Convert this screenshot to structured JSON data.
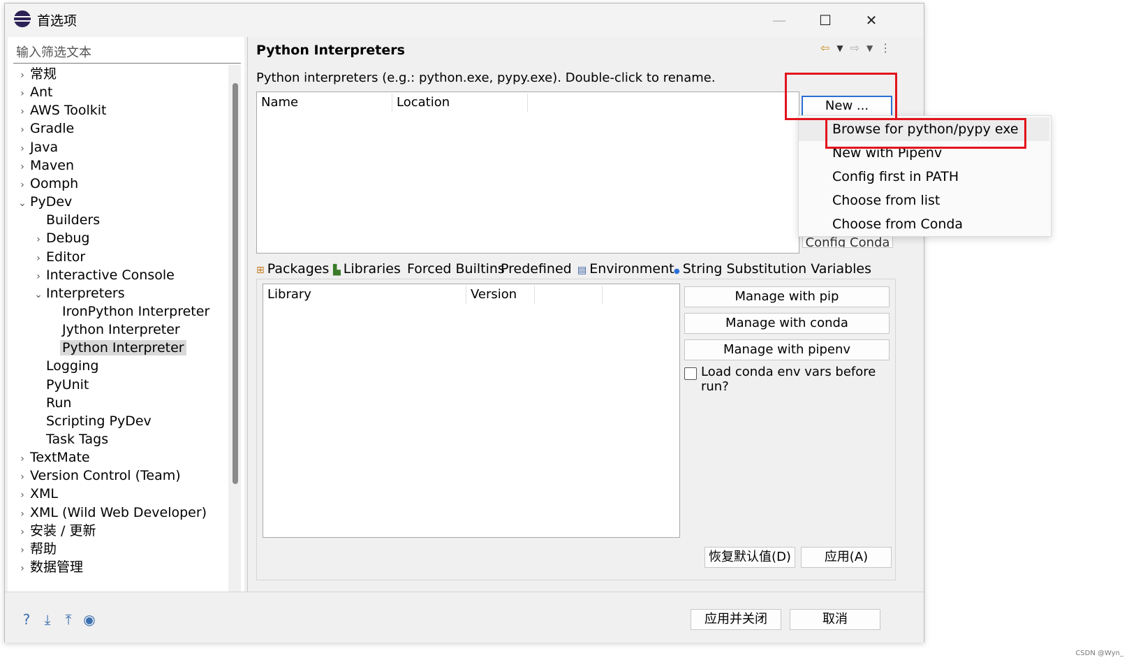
{
  "window": {
    "title": "首选项",
    "minimize_glyph": "—",
    "maximize_glyph": "☐",
    "close_glyph": "✕"
  },
  "sidebar": {
    "filter_placeholder": "输入筛选文本",
    "items": [
      {
        "label": "常规",
        "level": 0,
        "chevron": "›"
      },
      {
        "label": "Ant",
        "level": 0,
        "chevron": "›"
      },
      {
        "label": "AWS Toolkit",
        "level": 0,
        "chevron": "›"
      },
      {
        "label": "Gradle",
        "level": 0,
        "chevron": "›"
      },
      {
        "label": "Java",
        "level": 0,
        "chevron": "›"
      },
      {
        "label": "Maven",
        "level": 0,
        "chevron": "›"
      },
      {
        "label": "Oomph",
        "level": 0,
        "chevron": "›"
      },
      {
        "label": "PyDev",
        "level": 0,
        "chevron": "⌄"
      },
      {
        "label": "Builders",
        "level": 1,
        "chevron": ""
      },
      {
        "label": "Debug",
        "level": 1,
        "chevron": "›"
      },
      {
        "label": "Editor",
        "level": 1,
        "chevron": "›"
      },
      {
        "label": "Interactive Console",
        "level": 1,
        "chevron": "›"
      },
      {
        "label": "Interpreters",
        "level": 1,
        "chevron": "⌄"
      },
      {
        "label": "IronPython Interpreter",
        "level": 2,
        "chevron": ""
      },
      {
        "label": "Jython Interpreter",
        "level": 2,
        "chevron": ""
      },
      {
        "label": "Python Interpreter",
        "level": 2,
        "chevron": "",
        "selected": true
      },
      {
        "label": "Logging",
        "level": 1,
        "chevron": ""
      },
      {
        "label": "PyUnit",
        "level": 1,
        "chevron": ""
      },
      {
        "label": "Run",
        "level": 1,
        "chevron": ""
      },
      {
        "label": "Scripting PyDev",
        "level": 1,
        "chevron": ""
      },
      {
        "label": "Task Tags",
        "level": 1,
        "chevron": ""
      },
      {
        "label": "TextMate",
        "level": 0,
        "chevron": "›"
      },
      {
        "label": "Version Control (Team)",
        "level": 0,
        "chevron": "›"
      },
      {
        "label": "XML",
        "level": 0,
        "chevron": "›"
      },
      {
        "label": "XML (Wild Web Developer)",
        "level": 0,
        "chevron": "›"
      },
      {
        "label": "安装 / 更新",
        "level": 0,
        "chevron": "›"
      },
      {
        "label": "帮助",
        "level": 0,
        "chevron": "›"
      },
      {
        "label": "数据管理",
        "level": 0,
        "chevron": "›"
      }
    ]
  },
  "main": {
    "title": "Python Interpreters",
    "description": "Python interpreters (e.g.: python.exe, pypy.exe).   Double-click to rename.",
    "interpreters_table": {
      "columns": [
        "Name",
        "Location"
      ]
    },
    "new_button": "New ...",
    "config_conda_partial": "Config Conda",
    "new_menu": {
      "items": [
        "Browse for python/pypy exe",
        "New with Pipenv",
        "Config first in PATH",
        "Choose from list",
        "Choose from Conda"
      ]
    },
    "tabs": [
      {
        "label": "Packages",
        "icon": "⊞"
      },
      {
        "label": "Libraries",
        "icon": "▙"
      },
      {
        "label": "Forced Builtins",
        "icon": ""
      },
      {
        "label": "Predefined",
        "icon": ""
      },
      {
        "label": "Environment",
        "icon": "▤"
      },
      {
        "label": "String Substitution Variables",
        "icon": "●"
      }
    ],
    "packages_table": {
      "columns": [
        "Library",
        "Version"
      ]
    },
    "manage_pip": "Manage with pip",
    "manage_conda": "Manage with conda",
    "manage_pipenv": "Manage with pipenv",
    "load_conda_checkbox": "Load conda env vars before run?",
    "restore_defaults": "恢复默认值(D)",
    "apply": "应用(A)"
  },
  "footer": {
    "apply_and_close": "应用并关闭",
    "cancel": "取消"
  },
  "watermark": "CSDN @Wyn_",
  "colors": {
    "highlight_red": "#e2141c",
    "default_button_border": "#2b6fd6",
    "selected_bg": "#d9d9d9"
  }
}
